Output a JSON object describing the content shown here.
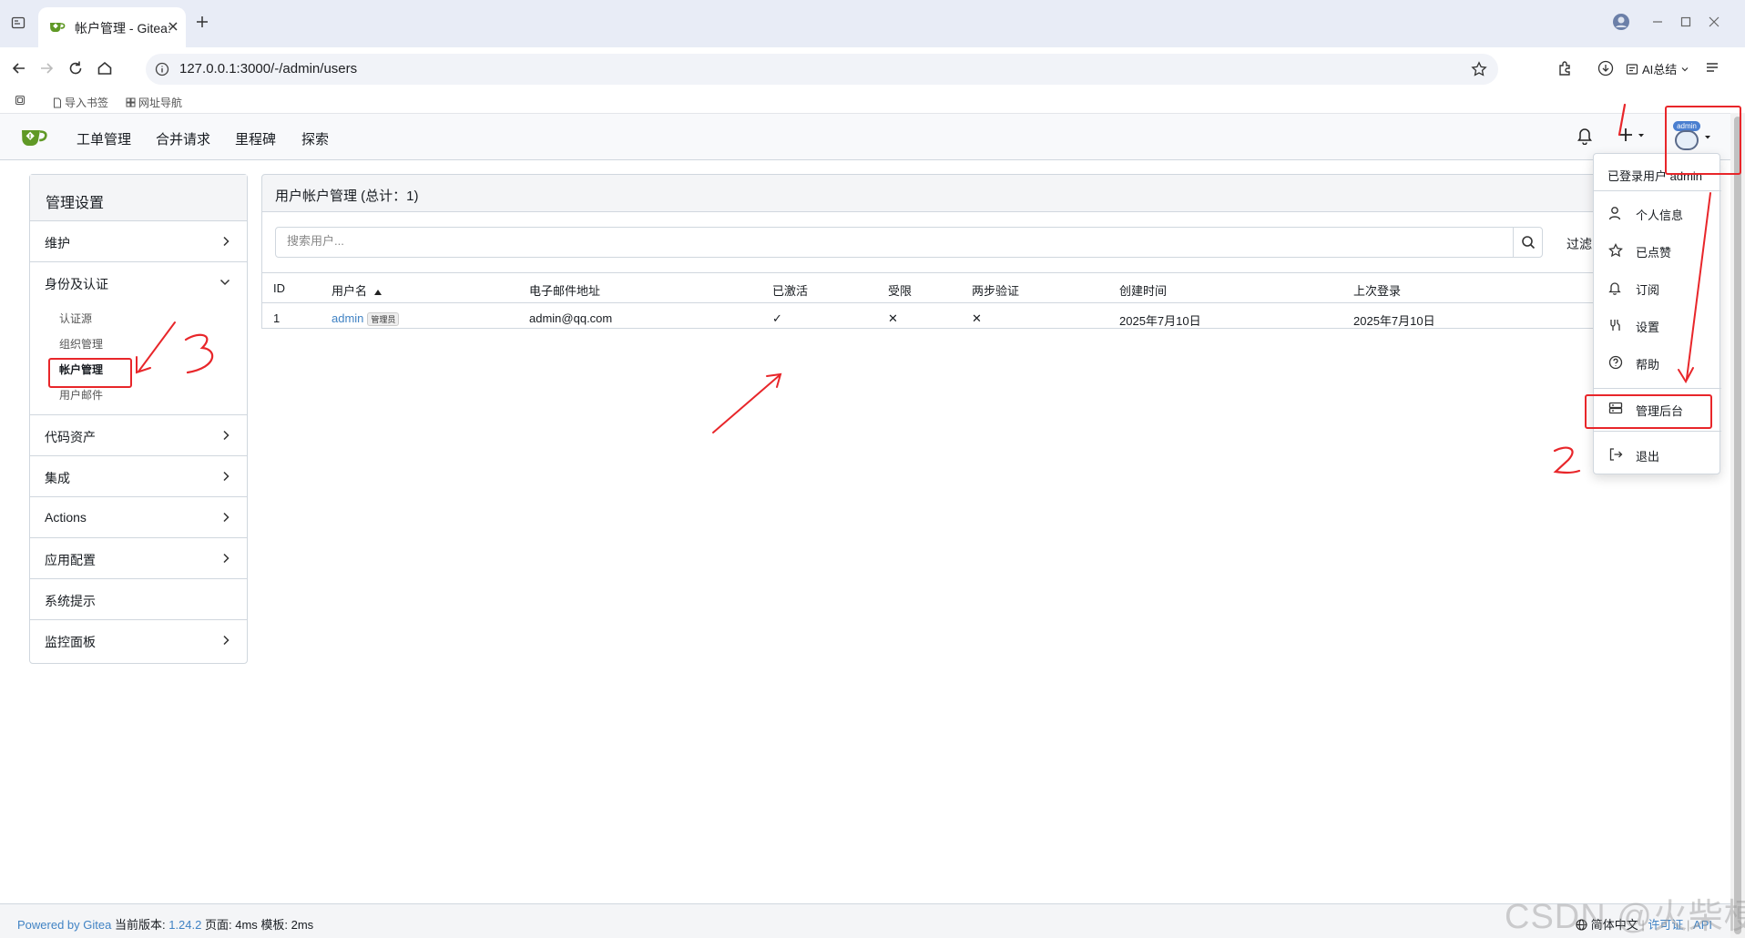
{
  "browser": {
    "tab_title": "帐户管理 - Gitea:",
    "url": "127.0.0.1:3000/-/admin/users",
    "ai_summary": "AI总结",
    "bookmarks": [
      "导入书签",
      "网址导航"
    ]
  },
  "nav": {
    "items": [
      "工单管理",
      "合并请求",
      "里程碑",
      "探索"
    ],
    "avatar_label": "admin"
  },
  "sidebar": {
    "header": "管理设置",
    "maintenance": "维护",
    "identity": {
      "label": "身份及认证",
      "subitems": [
        "认证源",
        "组织管理",
        "帐户管理",
        "用户邮件"
      ]
    },
    "code_assets": "代码资产",
    "integrations": "集成",
    "actions": "Actions",
    "app_config": "应用配置",
    "notices": "系统提示",
    "monitor": "监控面板"
  },
  "panel": {
    "title": "用户帐户管理 (总计：1)",
    "search_placeholder": "搜索用户...",
    "filter": "过滤",
    "columns": [
      "ID",
      "用户名",
      "电子邮件地址",
      "已激活",
      "受限",
      "两步验证",
      "创建时间",
      "上次登录"
    ],
    "rows": [
      {
        "id": "1",
        "username": "admin",
        "badge": "管理员",
        "email": "admin@qq.com",
        "activated": "✓",
        "restricted": "✕",
        "two_factor": "✕",
        "created": "2025年7月10日",
        "last_login": "2025年7月10日"
      }
    ]
  },
  "dropdown": {
    "signed_in": "已登录用户 admin",
    "items": [
      "个人信息",
      "已点赞",
      "订阅",
      "设置",
      "帮助",
      "管理后台",
      "退出"
    ]
  },
  "footer": {
    "powered": "Powered by Gitea",
    "version_label": "当前版本:",
    "version": "1.24.2",
    "page_time": "页面: 4ms 模板: 2ms",
    "language": "简体中文",
    "license": "许可证",
    "api": "API"
  },
  "watermark": "CSDN @火柴梗!",
  "annotations": [
    "1",
    "2",
    "3"
  ],
  "colors": {
    "accent": "#4183c4",
    "annotation": "#e8262a",
    "gitea_green": "#609926"
  }
}
